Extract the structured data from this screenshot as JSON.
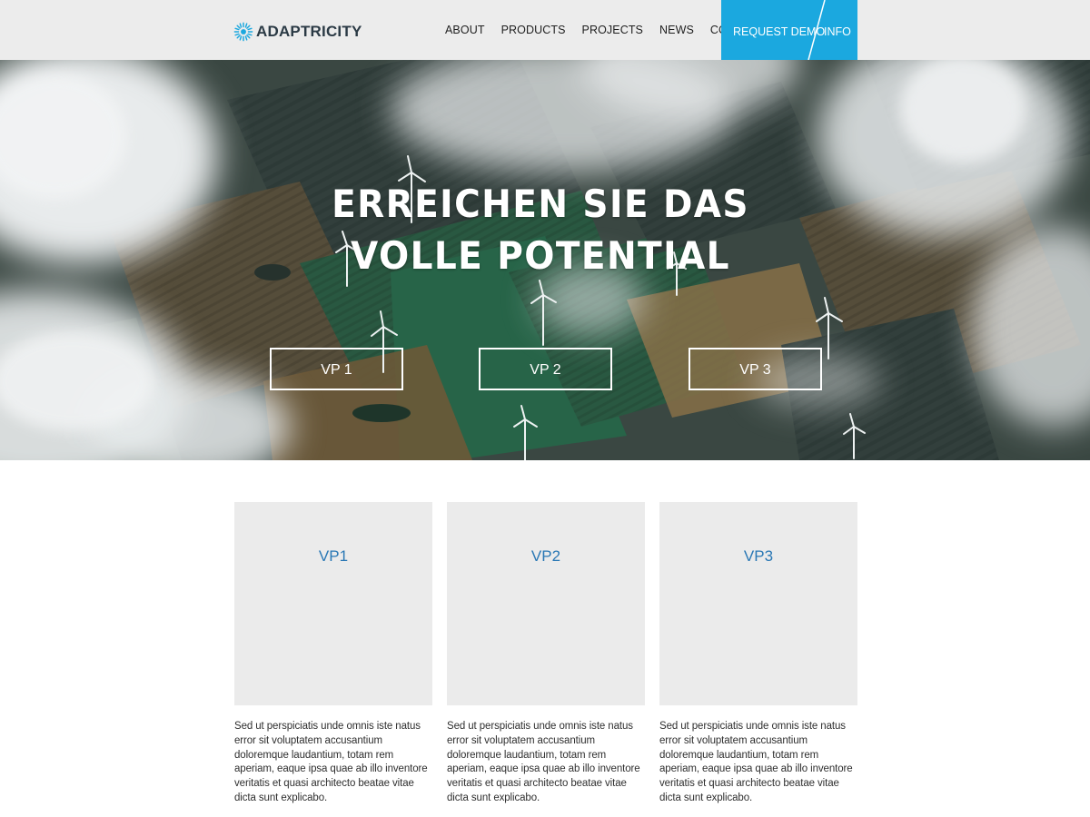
{
  "brand": {
    "name": "ADAPTRICITY",
    "logo_icon": "sunburst-logo-icon",
    "accent": "#1ba8df"
  },
  "nav": {
    "items": [
      {
        "label": "ABOUT"
      },
      {
        "label": "PRODUCTS"
      },
      {
        "label": "PROJECTS"
      },
      {
        "label": "NEWS"
      },
      {
        "label": "CONTACT"
      }
    ],
    "cta_demo": "REQUEST DEMO",
    "cta_info": "INFO"
  },
  "hero": {
    "title_line1": "ERREICHEN SIE DAS",
    "title_line2": "VOLLE POTENTIAL",
    "buttons": [
      {
        "label": "VP 1"
      },
      {
        "label": "VP 2"
      },
      {
        "label": "VP 3"
      }
    ]
  },
  "cards": [
    {
      "title": "VP1",
      "text": "Sed ut perspiciatis unde omnis iste natus error sit voluptatem accusantium doloremque laudantium, totam rem aperiam, eaque ipsa quae ab illo inventore veritatis et quasi architecto beatae vitae dicta sunt explicabo."
    },
    {
      "title": "VP2",
      "text": "Sed ut perspiciatis unde omnis iste natus error sit voluptatem accusantium doloremque laudantium, totam rem aperiam, eaque ipsa quae ab illo inventore veritatis et quasi architecto beatae vitae dicta sunt explicabo."
    },
    {
      "title": "VP3",
      "text": "Sed ut perspiciatis unde omnis iste natus error sit voluptatem accusantium doloremque laudantium, totam rem aperiam, eaque ipsa quae ab illo inventore veritatis et quasi architecto beatae vitae dicta sunt explicabo."
    }
  ]
}
